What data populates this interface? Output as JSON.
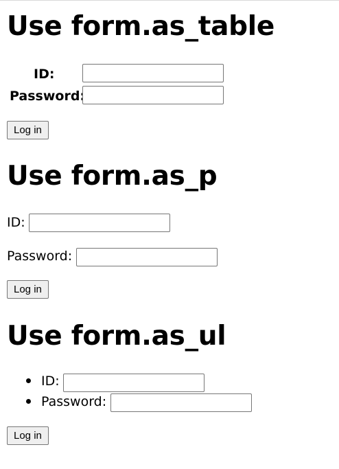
{
  "sections": [
    {
      "heading": "Use form.as_table",
      "fields": [
        {
          "label": "ID:",
          "value": ""
        },
        {
          "label": "Password:",
          "value": ""
        }
      ],
      "button": "Log in"
    },
    {
      "heading": "Use form.as_p",
      "fields": [
        {
          "label": "ID:",
          "value": ""
        },
        {
          "label": "Password:",
          "value": ""
        }
      ],
      "button": "Log in"
    },
    {
      "heading": "Use form.as_ul",
      "fields": [
        {
          "label": "ID:",
          "value": ""
        },
        {
          "label": "Password:",
          "value": ""
        }
      ],
      "button": "Log in"
    }
  ]
}
